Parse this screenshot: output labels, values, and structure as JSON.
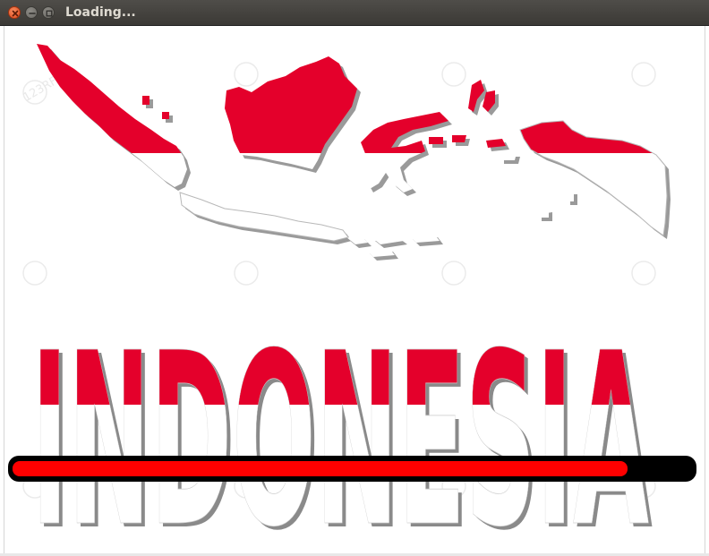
{
  "window": {
    "title": "Loading...",
    "controls": {
      "close_icon": "close-icon",
      "minimize_icon": "minimize-icon",
      "maximize_icon": "maximize-icon"
    }
  },
  "splash": {
    "word": "INDONESIA",
    "watermark": "123RF",
    "flag_colors": {
      "top": "#e4002b",
      "bottom": "#ffffff"
    },
    "map_shadow": "#888888"
  },
  "progress": {
    "value": 0.905,
    "fill_color": "#ff0000",
    "track_color": "#000000"
  }
}
